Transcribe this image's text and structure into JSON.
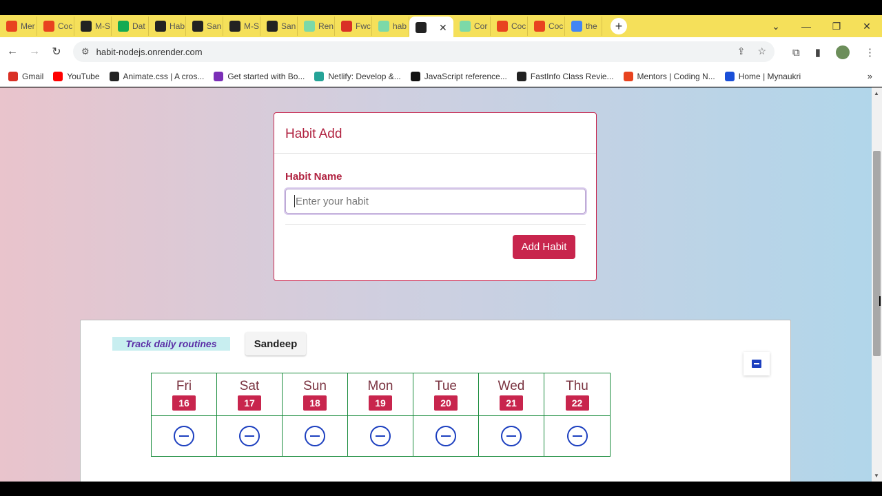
{
  "browser": {
    "tabs": [
      {
        "label": "Mer",
        "icon": "coding-ninjas-icon",
        "color": "#e8431f"
      },
      {
        "label": "Coc",
        "icon": "coding-ninjas-icon",
        "color": "#e8431f"
      },
      {
        "label": "M-S",
        "icon": "github-icon",
        "color": "#222222"
      },
      {
        "label": "Dat",
        "icon": "mongodb-icon",
        "color": "#13aa52"
      },
      {
        "label": "Hab",
        "icon": "ht-icon",
        "color": "#222222"
      },
      {
        "label": "San",
        "icon": "github-icon",
        "color": "#222222"
      },
      {
        "label": "M-S",
        "icon": "github-icon",
        "color": "#222222"
      },
      {
        "label": "San",
        "icon": "github-icon",
        "color": "#222222"
      },
      {
        "label": "Ren",
        "icon": "render-icon",
        "color": "#7cd9a8"
      },
      {
        "label": "Fwc",
        "icon": "gmail-icon",
        "color": "#d93025"
      },
      {
        "label": "hab",
        "icon": "render-icon",
        "color": "#7cd9a8"
      },
      {
        "label": "",
        "icon": "ht-icon",
        "color": "#222222",
        "active": true
      },
      {
        "label": "Cor",
        "icon": "render-icon",
        "color": "#7cd9a8"
      },
      {
        "label": "Coc",
        "icon": "coding-ninjas-icon",
        "color": "#e8431f"
      },
      {
        "label": "Coc",
        "icon": "coding-ninjas-icon",
        "color": "#e8431f"
      },
      {
        "label": "the",
        "icon": "google-icon",
        "color": "#4285f4"
      }
    ],
    "url": "habit-nodejs.onrender.com",
    "bookmarks": [
      {
        "label": "Gmail",
        "icon": "gmail-icon",
        "color": "#d93025"
      },
      {
        "label": "YouTube",
        "icon": "youtube-icon",
        "color": "#ff0000"
      },
      {
        "label": "Animate.css | A cros...",
        "icon": "animate-icon",
        "color": "#222222"
      },
      {
        "label": "Get started with Bo...",
        "icon": "bootstrap-icon",
        "color": "#7b2fb7"
      },
      {
        "label": "Netlify: Develop &...",
        "icon": "netlify-icon",
        "color": "#25a397"
      },
      {
        "label": "JavaScript reference...",
        "icon": "mdn-icon",
        "color": "#111111"
      },
      {
        "label": "FastInfo Class Revie...",
        "icon": "fastinfo-icon",
        "color": "#222222"
      },
      {
        "label": "Mentors | Coding N...",
        "icon": "coding-ninjas-icon",
        "color": "#e8431f"
      },
      {
        "label": "Home | Mynaukri",
        "icon": "mynaukri-icon",
        "color": "#1a4fd8"
      }
    ]
  },
  "form": {
    "title": "Habit Add",
    "label": "Habit Name",
    "placeholder": "Enter your habit",
    "button": "Add Habit"
  },
  "habit": {
    "description": "Track daily routines",
    "name": "Sandeep",
    "days": [
      {
        "name": "Fri",
        "date": "16"
      },
      {
        "name": "Sat",
        "date": "17"
      },
      {
        "name": "Sun",
        "date": "18"
      },
      {
        "name": "Mon",
        "date": "19"
      },
      {
        "name": "Tue",
        "date": "20"
      },
      {
        "name": "Wed",
        "date": "21"
      },
      {
        "name": "Thu",
        "date": "22"
      }
    ]
  },
  "colors": {
    "accent": "#c8254d",
    "status": "#1c3fbf",
    "grid": "#178a3a"
  }
}
